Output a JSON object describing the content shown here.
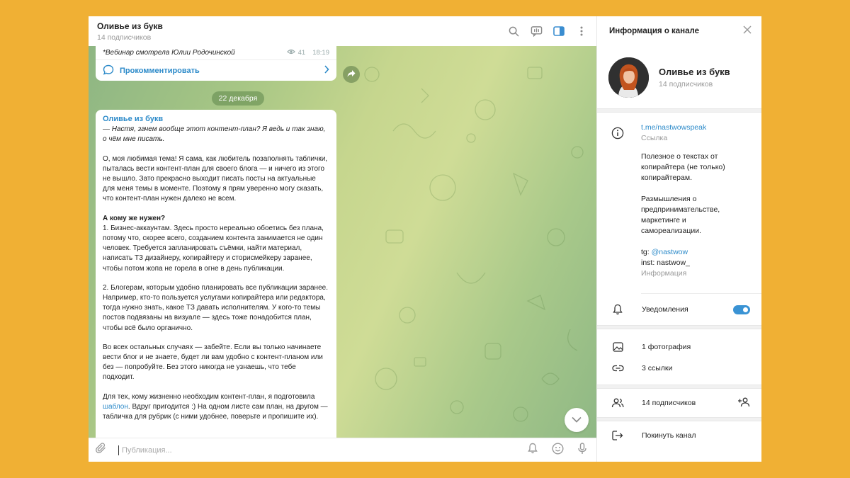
{
  "chat": {
    "title": "Оливье из букв",
    "subtitle": "14 подписчиков",
    "icons": [
      "search-icon",
      "live-stream-icon",
      "sidebar-toggle-icon",
      "more-icon"
    ]
  },
  "prev_message": {
    "text": "*Вебинар смотрела Юлии Родочинской",
    "views": "41",
    "time": "18:19",
    "comment_label": "Прокомментировать"
  },
  "date_separator": "22 декабря",
  "message": {
    "author": "Оливье из букв",
    "quote": "— Настя, зачем вообще этот контент-план? Я ведь и так знаю, о чём мне писать.",
    "p1": "О, моя любимая тема! Я сама, как любитель позаполнять таблички, пыталась вести контент-план для своего блога — и ничего из этого не вышло. Зато прекрасно выходит писать посты на актуальные для меня темы в моменте. Поэтому я прям уверенно могу сказать, что контент-план нужен далеко не всем.",
    "heading": "А кому же нужен?",
    "p2": "1. Бизнес-аккаунтам. Здесь просто нереально обоетись без плана, потому что, скорее всего, созданием контента занимается не один человек. Требуется запланировать съёмки, найти материал, написать ТЗ дизайнеру, копирайтеру и сторисмейкеру заранее, чтобы потом жопа не горела в огне в день публикации.",
    "p3": "2. Блогерам, которым удобно планировать все публикации заранее. Например, кто-то пользуется услугами копирайтера или редактора, тогда нужно знать, какое ТЗ давать исполнителям. У кого-то темы постов подвязаны на визуале — здесь тоже понадобится план, чтобы всё было органично.",
    "p4": "Во всех остальных случаях — забейте. Если вы только начинаете вести блог и не знаете, будет ли вам удобно с контент-планом или без — попробуйте. Без этого никогда не узнаешь, что тебе подходит.",
    "p5_before": "Для тех, кому жизненно необходим контент-план, я подготовила ",
    "p5_link": "шаблон",
    "p5_after": ". Вдруг пригодится :) На одном листе сам план, на другом — табличка для рубрик (с ними удобнее, поверьте и пропишите их)."
  },
  "compose": {
    "placeholder": "Публикация..."
  },
  "info": {
    "title": "Информация о канале",
    "name": "Оливье из букв",
    "subscribers": "14 подписчиков",
    "link": "t.me/nastwowspeak",
    "link_caption": "Ссылка",
    "desc1": "Полезное о текстах от копирайтера (не только) копирайтерам.",
    "desc2": "Размышления о предпринимательстве, маркетинге и самореализации.",
    "tg_prefix": "tg: ",
    "tg_handle": "@nastwow",
    "inst": "inst: nastwow_",
    "desc_caption": "Информация",
    "notifications": "Уведомления",
    "notifications_on": true,
    "photos": "1 фотография",
    "links": "3 ссылки",
    "members": "14 подписчиков",
    "leave": "Покинуть канал"
  },
  "colors": {
    "page_bg": "#f0b034",
    "accent": "#2c8ac9",
    "toggle": "#3a93d4"
  }
}
